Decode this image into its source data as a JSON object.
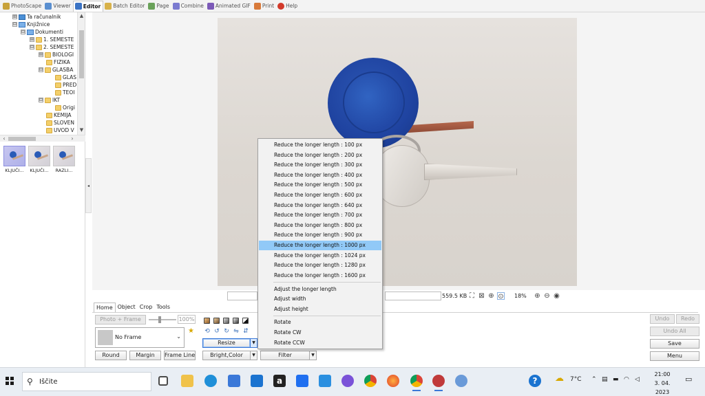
{
  "top_tabs": [
    {
      "label": "PhotoScape",
      "color": "#c8a23a"
    },
    {
      "label": "Viewer",
      "color": "#5a8fd0"
    },
    {
      "label": "Editor",
      "color": "#3b73c4"
    },
    {
      "label": "Batch Editor",
      "color": "#d8b24a"
    },
    {
      "label": "Page",
      "color": "#6aa25a"
    },
    {
      "label": "Combine",
      "color": "#7a7ad0"
    },
    {
      "label": "Animated GIF",
      "color": "#7c5ab8"
    },
    {
      "label": "Print",
      "color": "#d87a3a"
    },
    {
      "label": "Help",
      "color": "#d23a2a"
    }
  ],
  "tree": {
    "items": [
      {
        "label": "Ta računalnik",
        "expander": "⊞",
        "icon": "pc"
      },
      {
        "label": "Knjižnice",
        "expander": "⊟",
        "icon": "lib"
      },
      {
        "label": "Dokumenti",
        "expander": "⊟",
        "icon": "lib"
      },
      {
        "label": "1. SEMESTE",
        "expander": "⊞",
        "icon": "folder"
      },
      {
        "label": "2. SEMESTE",
        "expander": "⊟",
        "icon": "folder"
      },
      {
        "label": "BIOLOGI",
        "expander": "⊞",
        "icon": "folder"
      },
      {
        "label": "FIZIKA",
        "expander": "",
        "icon": "folder"
      },
      {
        "label": "GLASBA",
        "expander": "⊟",
        "icon": "folder"
      },
      {
        "label": "GLAS",
        "expander": "",
        "icon": "folder"
      },
      {
        "label": "PRED",
        "expander": "",
        "icon": "folder"
      },
      {
        "label": "TEOI",
        "expander": "",
        "icon": "folder"
      },
      {
        "label": "IKT",
        "expander": "⊟",
        "icon": "folder"
      },
      {
        "label": "Origi",
        "expander": "",
        "icon": "folder"
      },
      {
        "label": "KEMIJA",
        "expander": "",
        "icon": "folder"
      },
      {
        "label": "SLOVEN",
        "expander": "",
        "icon": "folder"
      },
      {
        "label": "UVOD V",
        "expander": "",
        "icon": "folder"
      }
    ]
  },
  "thumbnails": [
    {
      "label": "KLJUČI...",
      "selected": true
    },
    {
      "label": "KLJUČI...",
      "selected": false
    },
    {
      "label": "RAZLI...",
      "selected": false
    }
  ],
  "status": {
    "file_size": "559.5 KB",
    "zoom": "18%"
  },
  "panel": {
    "tabs": [
      "Home",
      "Object",
      "Crop",
      "Tools"
    ],
    "photo_frame_label": "Photo + Frame",
    "percent": "100%",
    "frame_select_value": "No Frame",
    "resize_label": "Resize",
    "round_label": "Round",
    "margin_label": "Margin",
    "frame_line_label": "Frame Line",
    "bright_color_label": "Bright,Color",
    "filter_label": "Filter"
  },
  "right_buttons": {
    "undo": "Undo",
    "redo": "Redo",
    "undo_all": "Undo All",
    "save": "Save",
    "menu": "Menu"
  },
  "resize_menu": {
    "group1": [
      "Reduce the longer length : 100 px",
      "Reduce the longer length : 200 px",
      "Reduce the longer length : 300 px",
      "Reduce the longer length : 400 px",
      "Reduce the longer length : 500 px",
      "Reduce the longer length : 600 px",
      "Reduce the longer length : 640 px",
      "Reduce the longer length : 700 px",
      "Reduce the longer length : 800 px",
      "Reduce the longer length : 900 px",
      "Reduce the longer length : 1000 px",
      "Reduce the longer length : 1024 px",
      "Reduce the longer length : 1280 px",
      "Reduce the longer length : 1600 px"
    ],
    "group2": [
      "Adjust the longer length",
      "Adjust width",
      "Adjust height"
    ],
    "group3": [
      "Rotate",
      "Rotate CW",
      "Rotate CCW"
    ],
    "highlighted_index": 10
  },
  "taskbar": {
    "search_placeholder": "Iščite",
    "weather": "7°C",
    "time": "21:00",
    "date": "3. 04. 2023",
    "apps": [
      {
        "name": "task-view-icon",
        "color": "#4a4a4a"
      },
      {
        "name": "file-explorer-icon",
        "color": "#f0c24a"
      },
      {
        "name": "edge-icon",
        "color": "#1f8fd8"
      },
      {
        "name": "store-icon",
        "color": "#3a78d8"
      },
      {
        "name": "mail-icon",
        "color": "#1a73d0"
      },
      {
        "name": "amazon-icon",
        "color": "#222222"
      },
      {
        "name": "dropbox-icon",
        "color": "#1f6ff0"
      },
      {
        "name": "myp-icon",
        "color": "#2a8fe0"
      },
      {
        "name": "app-icon",
        "color": "#7a52d8"
      },
      {
        "name": "chrome-icon",
        "color": "#2fa84f"
      },
      {
        "name": "firefox-icon",
        "color": "#ff7a1a"
      },
      {
        "name": "chrome-profile-icon",
        "color": "#d8403a"
      },
      {
        "name": "photoscape-icon",
        "color": "#c03a3a"
      },
      {
        "name": "photo-app-icon",
        "color": "#6a9ad8"
      }
    ]
  }
}
